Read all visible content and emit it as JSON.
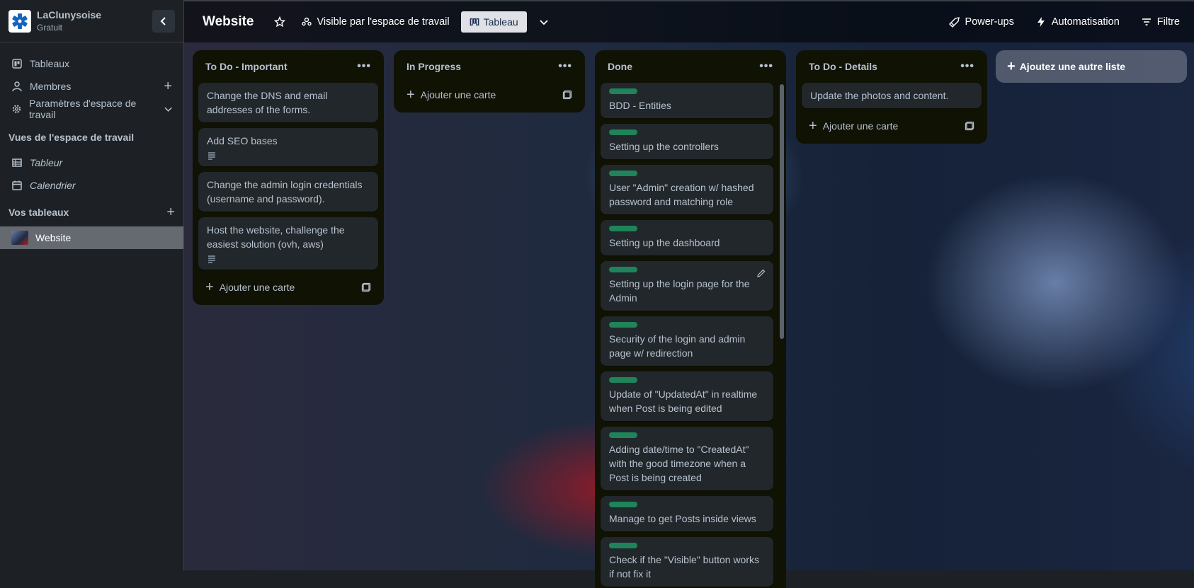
{
  "workspace": {
    "name": "LaClunysoise",
    "plan": "Gratuit"
  },
  "sidebar": {
    "items": [
      {
        "label": "Tableaux"
      },
      {
        "label": "Membres"
      },
      {
        "label": "Paramètres d'espace de travail"
      }
    ],
    "views_heading": "Vues de l'espace de travail",
    "views": [
      {
        "label": "Tableur"
      },
      {
        "label": "Calendrier"
      }
    ],
    "boards_heading": "Vos tableaux",
    "boards": [
      {
        "label": "Website"
      }
    ]
  },
  "header": {
    "board_title": "Website",
    "visibility": "Visible par l'espace de travail",
    "view_tab": "Tableau",
    "powerups": "Power-ups",
    "automation": "Automatisation",
    "filter": "Filtre"
  },
  "lists": [
    {
      "title": "To Do - Important",
      "cards": [
        {
          "text": "Change the DNS and email addresses of the forms."
        },
        {
          "text": "Add SEO bases"
        },
        {
          "text": "Change the admin login credentials (username and password)."
        },
        {
          "text": "Host the website, challenge the easiest solution (ovh, aws)"
        }
      ],
      "add_card": "Ajouter une carte"
    },
    {
      "title": "In Progress",
      "cards": [],
      "add_card": "Ajouter une carte"
    },
    {
      "title": "Done",
      "cards": [
        {
          "text": "BDD - Entities"
        },
        {
          "text": "Setting up the controllers"
        },
        {
          "text": "User \"Admin\" creation w/ hashed password and matching role"
        },
        {
          "text": "Setting up the dashboard"
        },
        {
          "text": "Setting up the login page for the Admin"
        },
        {
          "text": "Security of the login and admin page w/ redirection"
        },
        {
          "text": "Update of \"UpdatedAt\" in realtime when Post is being edited"
        },
        {
          "text": "Adding date/time to \"CreatedAt\" with the good timezone when a Post is being created"
        },
        {
          "text": "Manage to get Posts inside views"
        },
        {
          "text": "Check if the \"Visible\" button works if not fix it"
        }
      ]
    },
    {
      "title": "To Do - Details",
      "cards": [
        {
          "text": "Update the photos and content."
        }
      ],
      "add_card": "Ajouter une carte"
    }
  ],
  "add_list": "Ajoutez une autre liste",
  "colors": {
    "label_green": "#1f845a",
    "list_bg": "#101204",
    "card_bg": "#22272b"
  }
}
